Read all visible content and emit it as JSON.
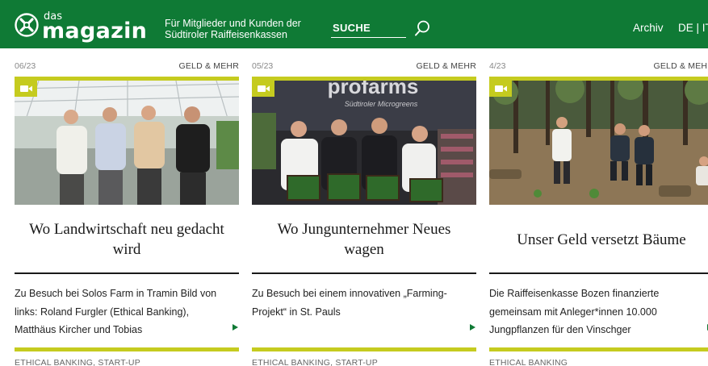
{
  "header": {
    "logo_small": "das",
    "logo_big": "magazin",
    "tagline_line1": "Für Mitglieder und Kunden der",
    "tagline_line2": "Südtiroler Raiffeisenkassen",
    "search_label": "SUCHE",
    "archive_link": "Archiv",
    "languages": "DE | IT",
    "background_color": "#0f7a35"
  },
  "accent_color": "#c5cb1f",
  "cards": [
    {
      "date": "06/23",
      "category": "GELD & MEHR",
      "title": "Wo Landwirtschaft neu gedacht wird",
      "excerpt": "Zu Besuch bei Solos Farm in Tramin Bild von links: Roland Furgler (Ethical Banking), Matthäus Kircher und Tobias",
      "tags": "ETHICAL BANKING, START-UP",
      "media_icon": "video-camera-icon"
    },
    {
      "date": "05/23",
      "category": "GELD & MEHR",
      "title": "Wo Jungunternehmer Neues wagen",
      "excerpt": "Zu Besuch bei einem innovativen „Farming-Projekt“ in St. Pauls",
      "tags": "ETHICAL BANKING, START-UP",
      "media_icon": "video-camera-icon",
      "image_text_1": "profarms",
      "image_text_2": "Südtiroler Microgreens"
    },
    {
      "date": "4/23",
      "category": "GELD & MEHR",
      "title": "Unser Geld versetzt Bäume",
      "excerpt": "Die Raiffeisenkasse Bozen finanzierte gemeinsam mit Anleger*innen 10.000 Jungpflanzen für den Vinschger",
      "tags": "ETHICAL BANKING",
      "media_icon": "video-camera-icon"
    }
  ]
}
